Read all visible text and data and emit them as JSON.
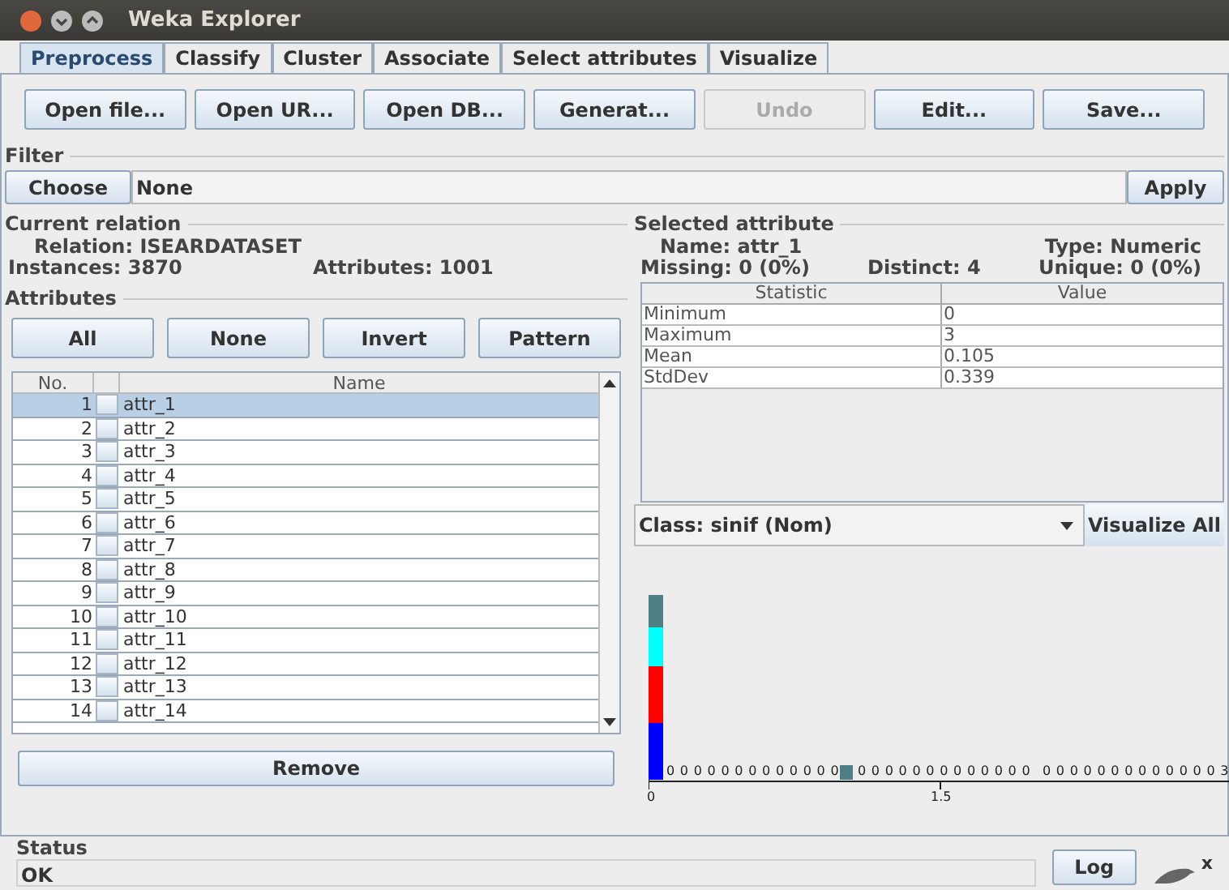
{
  "window": {
    "title": "Weka Explorer"
  },
  "tabs": [
    {
      "label": "Preprocess",
      "selected": true
    },
    {
      "label": "Classify",
      "selected": false
    },
    {
      "label": "Cluster",
      "selected": false
    },
    {
      "label": "Associate",
      "selected": false
    },
    {
      "label": "Select attributes",
      "selected": false
    },
    {
      "label": "Visualize",
      "selected": false
    }
  ],
  "toolbar": [
    {
      "label": "Open file...",
      "disabled": false
    },
    {
      "label": "Open UR...",
      "disabled": false
    },
    {
      "label": "Open DB...",
      "disabled": false
    },
    {
      "label": "Generat...",
      "disabled": false
    },
    {
      "label": "Undo",
      "disabled": true
    },
    {
      "label": "Edit...",
      "disabled": false
    },
    {
      "label": "Save...",
      "disabled": false
    }
  ],
  "filter": {
    "title": "Filter",
    "choose": "Choose",
    "value": "None",
    "apply": "Apply"
  },
  "current_relation": {
    "title": "Current relation",
    "relation": "Relation: ISEARDATASET",
    "instances": "Instances: 3870",
    "attributes": "Attributes: 1001"
  },
  "attributes": {
    "title": "Attributes",
    "buttons": [
      "All",
      "None",
      "Invert",
      "Pattern"
    ],
    "columns": [
      "No.",
      "Name"
    ],
    "rows": [
      {
        "no": "1",
        "name": "attr_1",
        "checked": false,
        "selected": true
      },
      {
        "no": "2",
        "name": "attr_2",
        "checked": false,
        "selected": false
      },
      {
        "no": "3",
        "name": "attr_3",
        "checked": false,
        "selected": false
      },
      {
        "no": "4",
        "name": "attr_4",
        "checked": false,
        "selected": false
      },
      {
        "no": "5",
        "name": "attr_5",
        "checked": false,
        "selected": false
      },
      {
        "no": "6",
        "name": "attr_6",
        "checked": false,
        "selected": false
      },
      {
        "no": "7",
        "name": "attr_7",
        "checked": false,
        "selected": false
      },
      {
        "no": "8",
        "name": "attr_8",
        "checked": false,
        "selected": false
      },
      {
        "no": "9",
        "name": "attr_9",
        "checked": false,
        "selected": false
      },
      {
        "no": "10",
        "name": "attr_10",
        "checked": false,
        "selected": false
      },
      {
        "no": "11",
        "name": "attr_11",
        "checked": false,
        "selected": false
      },
      {
        "no": "12",
        "name": "attr_12",
        "checked": false,
        "selected": false
      },
      {
        "no": "13",
        "name": "attr_13",
        "checked": false,
        "selected": false
      },
      {
        "no": "14",
        "name": "attr_14",
        "checked": false,
        "selected": false
      }
    ],
    "remove": "Remove"
  },
  "selected_attribute": {
    "title": "Selected attribute",
    "name": "Name: attr_1",
    "type": "Type: Numeric",
    "missing": "Missing: 0 (0%)",
    "distinct": "Distinct: 4",
    "unique": "Unique: 0 (0%)",
    "columns": [
      "Statistic",
      "Value"
    ],
    "rows": [
      {
        "statistic": "Minimum",
        "value": "0"
      },
      {
        "statistic": "Maximum",
        "value": "3"
      },
      {
        "statistic": "Mean",
        "value": "0.105"
      },
      {
        "statistic": "StdDev",
        "value": "0.339"
      }
    ]
  },
  "class_select": {
    "value": "Class: sinif (Nom)",
    "visualize_all": "Visualize All"
  },
  "histogram": {
    "count_labels": [
      "0 0 0 0 0 0 0 0 0 0 0 0 0",
      "0 0 0 0 0 0 0 0 0 0 0 0 0",
      "0 0 0 0 0 0 0 0 0 0 0 0 0 3"
    ],
    "axis_labels": [
      "0",
      "1.5"
    ]
  },
  "status": {
    "title": "Status",
    "text": "OK",
    "log": "Log",
    "x": "x"
  }
}
